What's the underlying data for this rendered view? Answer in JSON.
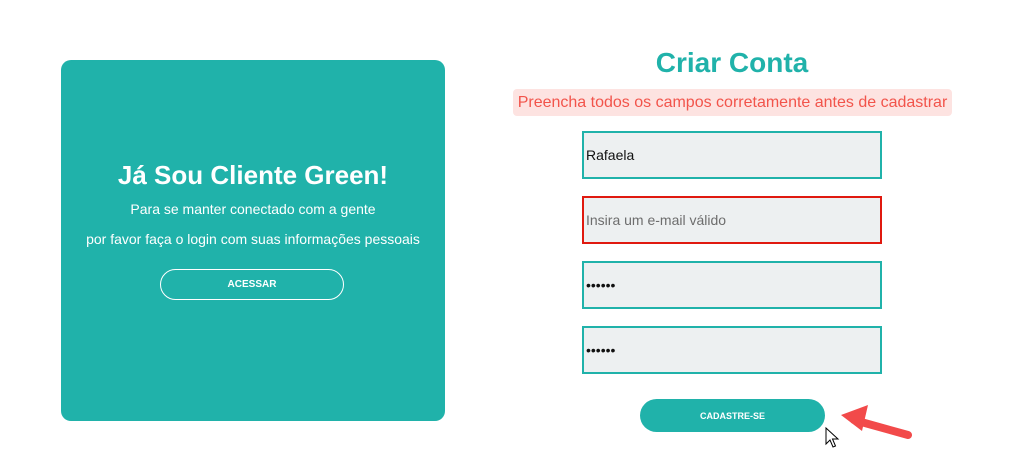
{
  "left_panel": {
    "title": "Já Sou Cliente Green!",
    "text_line_1": "Para se manter conectado com a gente",
    "text_line_2": "por favor faça o login com suas informações pessoais",
    "access_button_label": "ACESSAR",
    "background_color": "#20b2aa"
  },
  "form": {
    "title": "Criar Conta",
    "error_message": "Preencha todos os campos corretamente antes de cadastrar",
    "fields": {
      "name": {
        "value": "Rafaela",
        "placeholder": ""
      },
      "email": {
        "value": "",
        "placeholder": "Insira um e-mail válido",
        "state": "invalid"
      },
      "password": {
        "value": "••••••"
      },
      "confirm_password": {
        "value": "••••••"
      }
    },
    "submit_label": "CADASTRE-SE"
  },
  "colors": {
    "accent": "#20b2aa",
    "error_text": "#f2544b",
    "error_background": "#fde3e1",
    "invalid_border": "#e0190f",
    "annotation_arrow": "#f24a4a"
  },
  "icons": {
    "arrow": "red-arrow-icon",
    "cursor": "mouse-pointer-icon"
  }
}
